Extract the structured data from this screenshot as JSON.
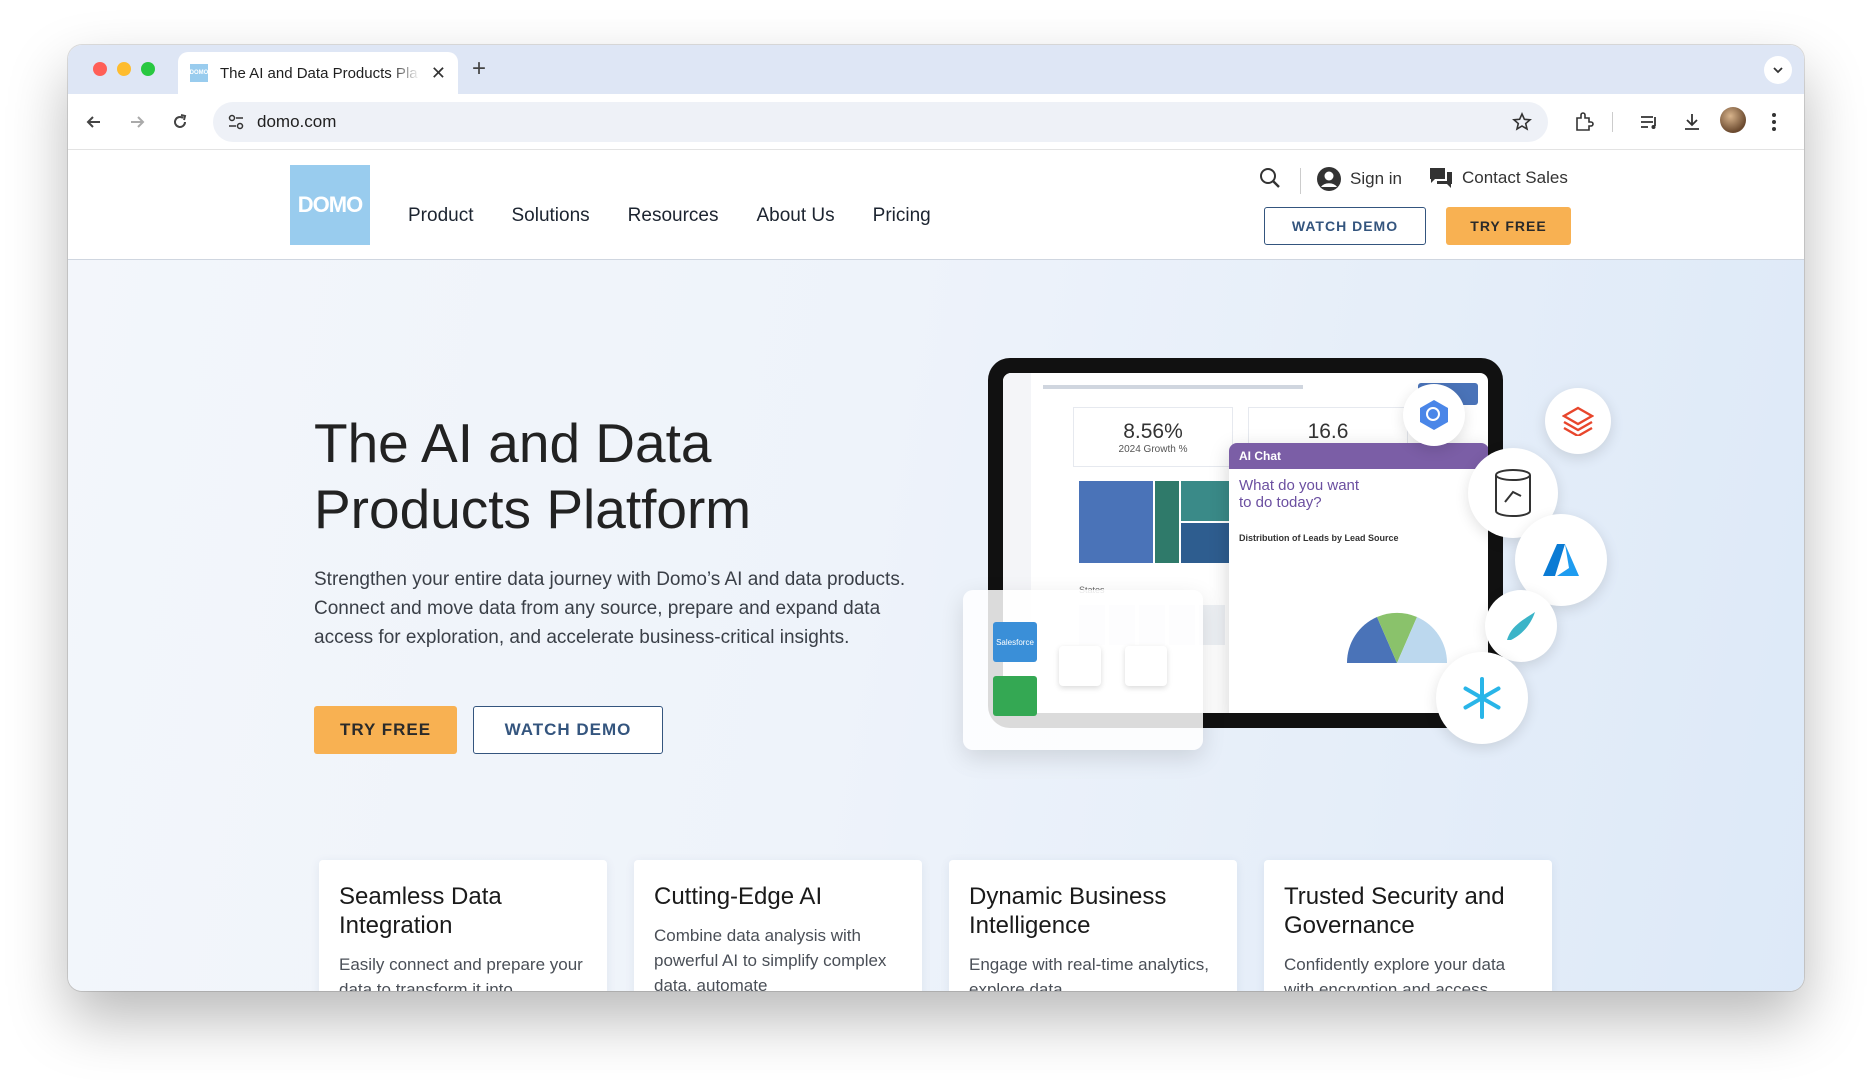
{
  "browser": {
    "tab_title": "The AI and Data Products Pla",
    "url": "domo.com"
  },
  "site": {
    "logo_text": "DOMO",
    "nav": [
      "Product",
      "Solutions",
      "Resources",
      "About Us",
      "Pricing"
    ],
    "sign_in": "Sign in",
    "contact_sales": "Contact Sales",
    "watch_demo": "WATCH DEMO",
    "try_free": "TRY FREE"
  },
  "hero": {
    "title_line1": "The AI and Data",
    "title_line2": "Products Platform",
    "description": "Strengthen your entire data journey with Domo’s AI and data products. Connect and move data from any source, prepare and expand data access for exploration, and accelerate business-critical insights.",
    "try_free": "TRY FREE",
    "watch_demo": "WATCH DEMO"
  },
  "dashboard": {
    "kpi1_value": "8.56%",
    "kpi1_label": "2024 Growth %",
    "kpi2_value": "16.6",
    "ai_chat_title": "AI Chat",
    "ai_chat_prompt": "What do you want to do today?",
    "ai_chart_title": "Distribution of Leads by Lead Source",
    "states_label": "States",
    "salesforce_label": "Salesforce"
  },
  "features": [
    {
      "title": "Seamless Data Integration",
      "text": "Easily connect and prepare your data to transform it into"
    },
    {
      "title": "Cutting-Edge AI",
      "text": "Combine data analysis with powerful AI to simplify complex data, automate"
    },
    {
      "title": "Dynamic Business Intelligence",
      "text": "Engage with real-time analytics, explore data"
    },
    {
      "title": "Trusted Security and Governance",
      "text": "Confidently explore your data with encryption and access"
    }
  ]
}
